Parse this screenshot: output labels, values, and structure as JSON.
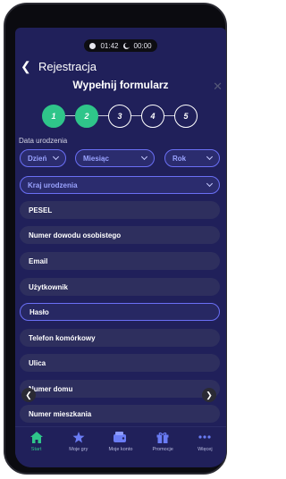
{
  "status": {
    "time": "01:42",
    "timer": "00:00"
  },
  "header": {
    "title": "Rejestracja"
  },
  "form": {
    "title": "Wypełnij formularz",
    "steps": [
      "1",
      "2",
      "3",
      "4",
      "5"
    ],
    "active_steps": 2,
    "dob_label": "Data urodzenia",
    "day": "Dzień",
    "month": "Miesiąc",
    "year": "Rok",
    "birth_country": "Kraj urodzenia",
    "fields": [
      "PESEL",
      "Numer dowodu osobistego",
      "Email",
      "Użytkownik",
      "Hasło",
      "Telefon komórkowy",
      "Ulica",
      "Numer domu",
      "Numer mieszkania"
    ]
  },
  "tabs": [
    {
      "label": "Start",
      "icon": "home-icon"
    },
    {
      "label": "Moje gry",
      "icon": "star-icon"
    },
    {
      "label": "Moje konto",
      "icon": "wallet-icon"
    },
    {
      "label": "Promocje",
      "icon": "gift-icon"
    },
    {
      "label": "Więcej",
      "icon": "more-icon"
    }
  ],
  "colors": {
    "accent": "#2fc58a",
    "background": "#20205a",
    "field": "#2e2f5e",
    "outline": "#6a6ff5"
  }
}
